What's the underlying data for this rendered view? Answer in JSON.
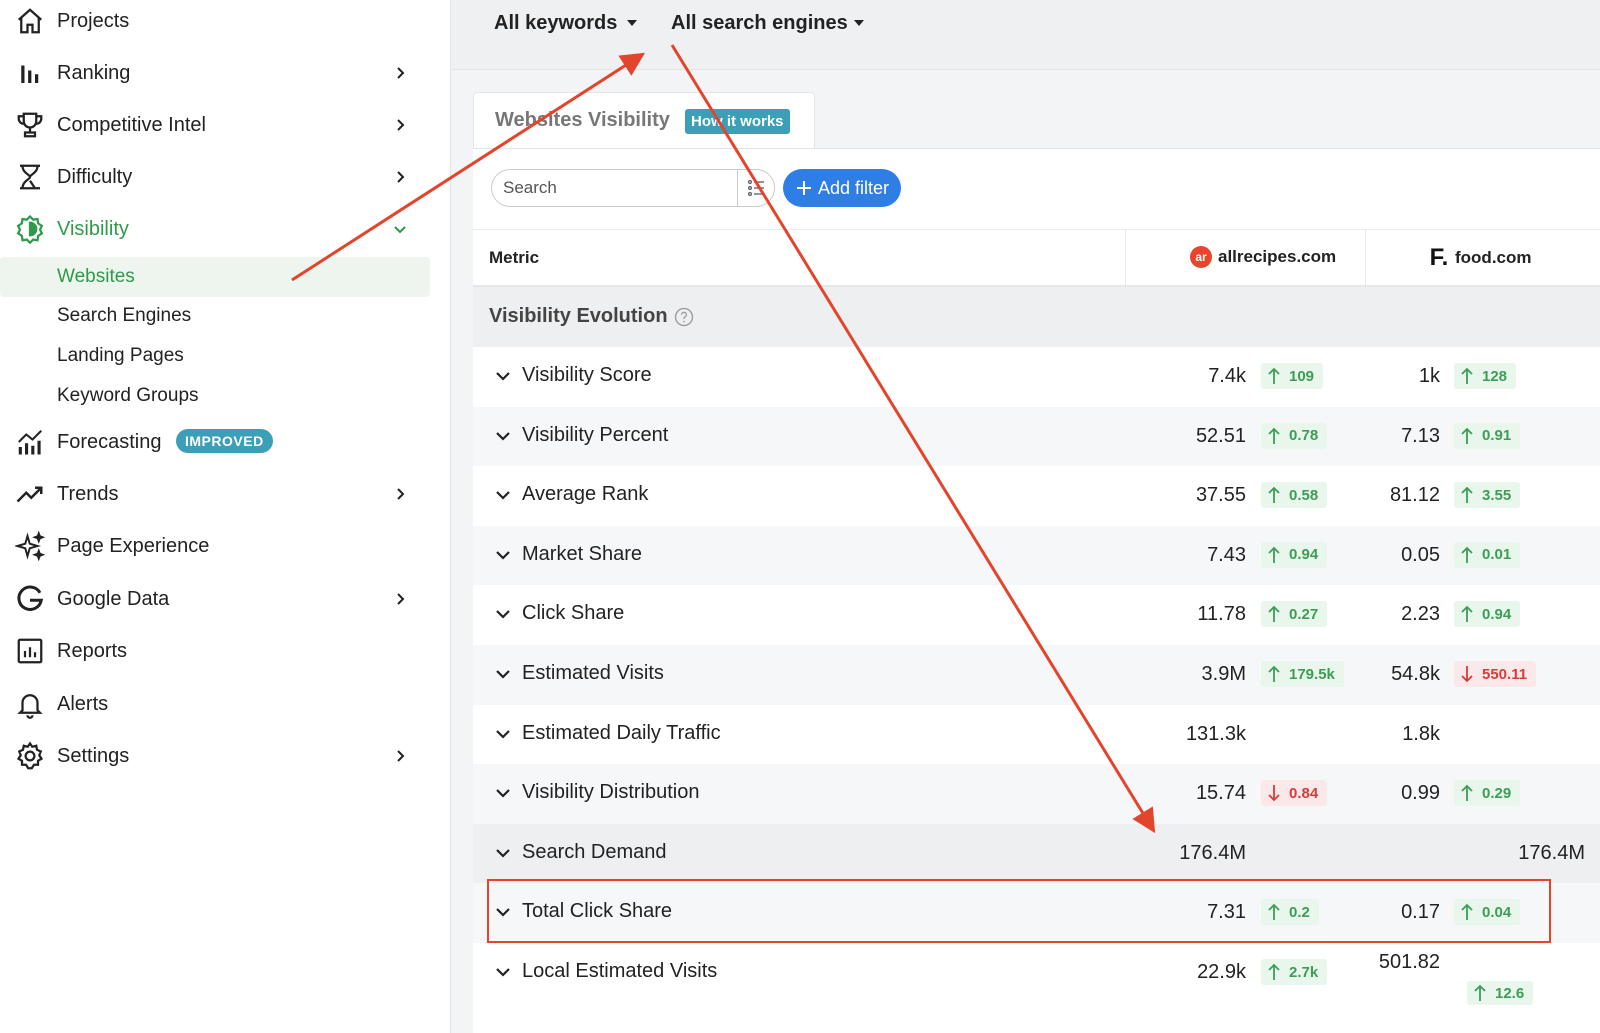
{
  "sidebar": {
    "items": [
      {
        "label": "Projects"
      },
      {
        "label": "Ranking"
      },
      {
        "label": "Competitive Intel"
      },
      {
        "label": "Difficulty"
      },
      {
        "label": "Visibility"
      },
      {
        "label": "Forecasting",
        "badge": "IMPROVED"
      },
      {
        "label": "Trends"
      },
      {
        "label": "Page Experience"
      },
      {
        "label": "Google Data"
      },
      {
        "label": "Reports"
      },
      {
        "label": "Alerts"
      },
      {
        "label": "Settings"
      }
    ],
    "visibility_sub": [
      {
        "label": "Websites"
      },
      {
        "label": "Search Engines"
      },
      {
        "label": "Landing Pages"
      },
      {
        "label": "Keyword Groups"
      }
    ]
  },
  "topbar": {
    "keywords_filter": "All keywords",
    "engines_filter": "All search engines"
  },
  "tab": {
    "title": "Websites Visibility",
    "how_it_works": "How it works"
  },
  "toolbar": {
    "search_placeholder": "Search",
    "add_filter_label": "Add filter"
  },
  "table": {
    "metric_header": "Metric",
    "sites": [
      {
        "name": "allrecipes.com",
        "logo_text": "ar"
      },
      {
        "name": "food.com",
        "logo_text": "F."
      }
    ],
    "section_title": "Visibility Evolution",
    "rows": [
      {
        "label": "Visibility Score",
        "a": "7.4k",
        "a_chg": "109",
        "a_dir": "up",
        "b": "1k",
        "b_chg": "128",
        "b_dir": "up"
      },
      {
        "label": "Visibility Percent",
        "a": "52.51",
        "a_chg": "0.78",
        "a_dir": "up",
        "b": "7.13",
        "b_chg": "0.91",
        "b_dir": "up"
      },
      {
        "label": "Average Rank",
        "a": "37.55",
        "a_chg": "0.58",
        "a_dir": "up",
        "b": "81.12",
        "b_chg": "3.55",
        "b_dir": "up"
      },
      {
        "label": "Market Share",
        "a": "7.43",
        "a_chg": "0.94",
        "a_dir": "up",
        "b": "0.05",
        "b_chg": "0.01",
        "b_dir": "up"
      },
      {
        "label": "Click Share",
        "a": "11.78",
        "a_chg": "0.27",
        "a_dir": "up",
        "b": "2.23",
        "b_chg": "0.94",
        "b_dir": "up"
      },
      {
        "label": "Estimated Visits",
        "a": "3.9M",
        "a_chg": "179.5k",
        "a_dir": "up",
        "b": "54.8k",
        "b_chg": "550.11",
        "b_dir": "down"
      },
      {
        "label": "Estimated Daily Traffic",
        "a": "131.3k",
        "a_chg": "",
        "a_dir": "",
        "b": "1.8k",
        "b_chg": "",
        "b_dir": ""
      },
      {
        "label": "Visibility Distribution",
        "a": "15.74",
        "a_chg": "0.84",
        "a_dir": "down",
        "b": "0.99",
        "b_chg": "0.29",
        "b_dir": "up"
      },
      {
        "label": "Search Demand",
        "a": "176.4M",
        "a_chg": "",
        "a_dir": "",
        "b": "176.4M",
        "b_chg": "",
        "b_dir": ""
      },
      {
        "label": "Total Click Share",
        "a": "7.31",
        "a_chg": "0.2",
        "a_dir": "up",
        "b": "0.17",
        "b_chg": "0.04",
        "b_dir": "up"
      },
      {
        "label": "Local Estimated Visits",
        "a": "22.9k",
        "a_chg": "2.7k",
        "a_dir": "up",
        "b": "501.82",
        "b_chg": "12.6",
        "b_dir": "up"
      }
    ]
  },
  "colors": {
    "brand_green": "#2e9a4a",
    "accent_blue": "#2f7ee6",
    "badge_teal": "#3a9fb7",
    "annotation_red": "#e2442c"
  }
}
